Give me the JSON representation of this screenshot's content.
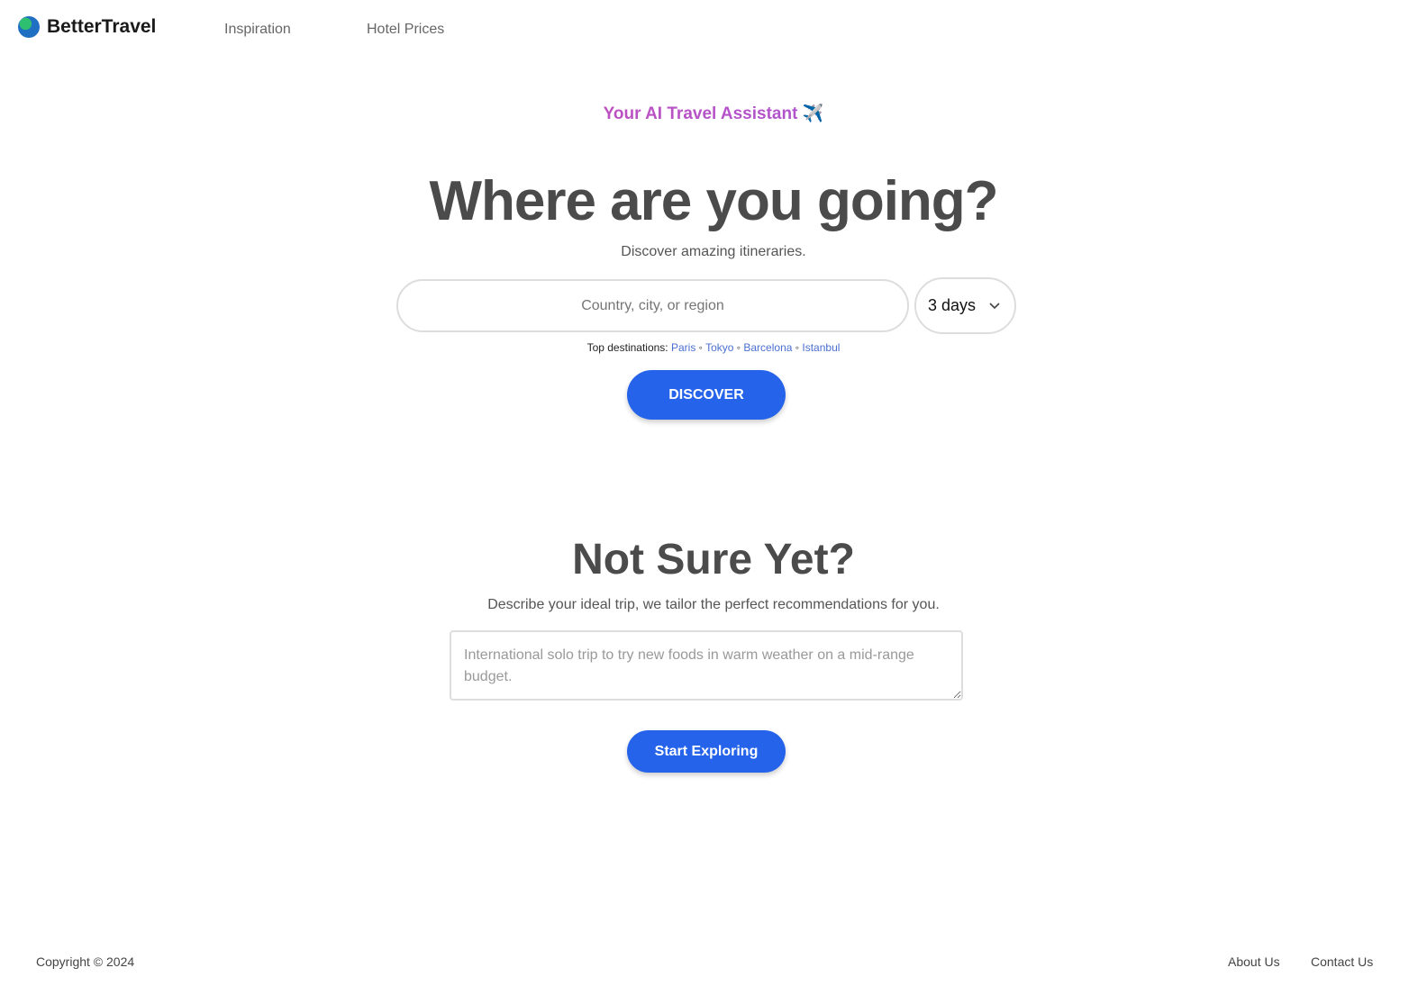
{
  "nav": {
    "brand": "BetterTravel",
    "links": [
      "Inspiration",
      "Hotel Prices"
    ]
  },
  "hero": {
    "tagline": "Your AI Travel Assistant",
    "tagline_icon": "✈️",
    "title": "Where are you going?",
    "subtitle": "Discover amazing itineraries.",
    "search_placeholder": "Country, city, or region",
    "days_selected": "3 days",
    "top_label": "Top destinations:",
    "destinations": [
      "Paris",
      "Tokyo",
      "Barcelona",
      "Istanbul"
    ],
    "separator": "◦",
    "discover_label": "DISCOVER"
  },
  "explore": {
    "title": "Not Sure Yet?",
    "subtitle": "Describe your ideal trip, we tailor the perfect recommendations for you.",
    "placeholder": "International solo trip to try new foods in warm weather on a mid-range budget.",
    "button": "Start Exploring"
  },
  "footer": {
    "copyright": "Copyright © 2024",
    "links": [
      "About Us",
      "Contact Us"
    ]
  },
  "colors": {
    "primary": "#2563eb",
    "gradient_start": "#e0489a",
    "gradient_end": "#8b5cf6"
  }
}
